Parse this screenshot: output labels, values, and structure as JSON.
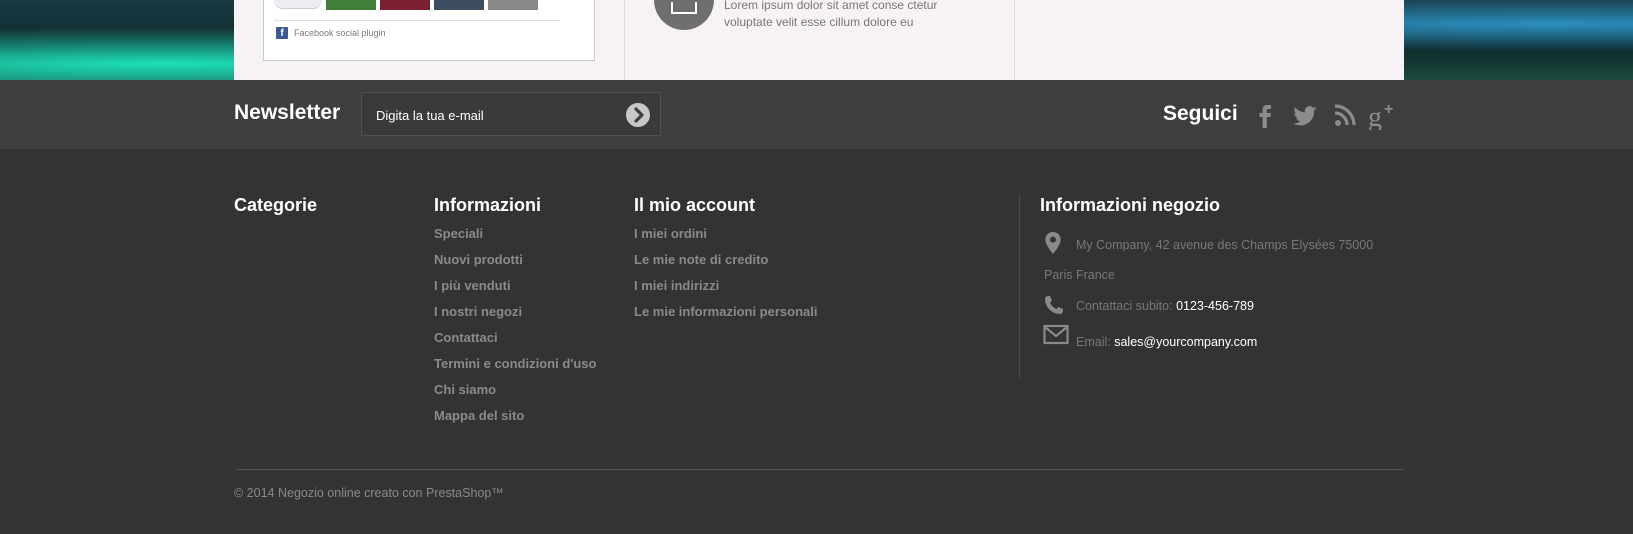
{
  "facebook": {
    "plugin_label": "Facebook social plugin",
    "thumb_colors": [
      "#3f7f3a",
      "#7a2030",
      "#3d4e63",
      "#888a8a"
    ]
  },
  "lorem": {
    "text": "Lorem ipsum dolor sit amet conse ctetur voluptate velit esse cillum dolore eu"
  },
  "newsletter": {
    "title": "Newsletter",
    "placeholder": "Digita la tua e-mail"
  },
  "follow": {
    "title": "Seguici",
    "icons": [
      "facebook-icon",
      "twitter-icon",
      "rss-icon",
      "google-plus-icon"
    ]
  },
  "footer": {
    "categories": {
      "title": "Categorie"
    },
    "info": {
      "title": "Informazioni",
      "items": [
        "Speciali",
        "Nuovi prodotti",
        "I più venduti",
        "I nostri negozi",
        "Contattaci",
        "Termini e condizioni d'uso",
        "Chi siamo",
        "Mappa del sito"
      ]
    },
    "account": {
      "title": "Il mio account",
      "items": [
        "I miei ordini",
        "Le mie note di credito",
        "I miei indirizzi",
        "Le mie informazioni personali"
      ]
    },
    "store": {
      "title": "Informazioni negozio",
      "address_line1": "My Company, 42 avenue des Champs Elysées 75000",
      "address_line2": "Paris France",
      "phone_label": "Contattaci subito:",
      "phone": "0123-456-789",
      "email_label": "Email:",
      "email": "sales@yourcompany.com"
    },
    "copyright": "© 2014 Negozio online creato con PrestaShop™"
  },
  "colors": {
    "footer_bg": "#333333",
    "bar_bg": "#3e3e3e",
    "link": "#8a8a8a"
  }
}
